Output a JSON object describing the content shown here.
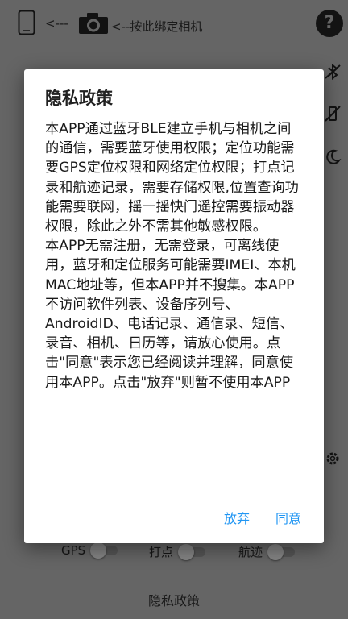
{
  "app": {
    "header": {
      "bind_prefix": "<---",
      "bind_text": "<--按此绑定相机",
      "help_label": "?"
    },
    "toggles": [
      {
        "label": "GPS",
        "on": false
      },
      {
        "label": "打点",
        "on": false
      },
      {
        "label": "航迹",
        "on": false
      }
    ],
    "privacy_link": "隐私政策"
  },
  "dialog": {
    "title": "隐私政策",
    "body": "本APP通过蓝牙BLE建立手机与相机之间的通信，需要蓝牙使用权限；定位功能需要GPS定位权限和网络定位权限；打点记录和航迹记录，需要存储权限,位置查询功能需要联网，摇一摇快门遥控需要振动器权限，除此之外不需其他敏感权限。\n本APP无需注册，无需登录，可离线使用，蓝牙和定位服务可能需要IMEI、本机MAC地址等，但本APP并不搜集。本APP不访问软件列表、设备序列号、AndroidID、电话记录、通信录、短信、录音、相机、日历等，请放心使用。点击\"同意\"表示您已经阅读并理解，同意使用本APP。点击\"放弃\"则暂不使用本APP",
    "reject_label": "放弃",
    "accept_label": "同意"
  },
  "colors": {
    "accent": "#2196f3",
    "background": "#a3a3a3",
    "dialog_bg": "#ffffff"
  },
  "icons": [
    "phone-icon",
    "camera-icon",
    "help-icon",
    "bluetooth-icon",
    "vibrate-icon",
    "night-mode-icon",
    "gear-icon"
  ]
}
